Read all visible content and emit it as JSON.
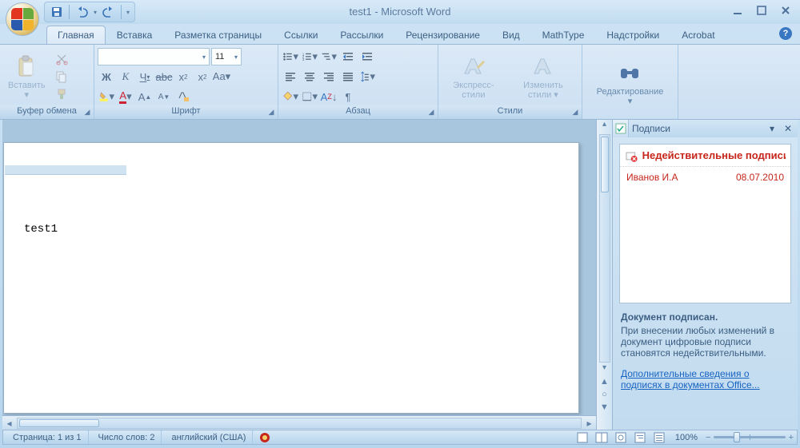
{
  "title": "test1 - Microsoft Word",
  "tabs": {
    "home": "Главная",
    "insert": "Вставка",
    "layout": "Разметка страницы",
    "refs": "Ссылки",
    "mail": "Рассылки",
    "review": "Рецензирование",
    "view": "Вид",
    "mathtype": "MathType",
    "addins": "Надстройки",
    "acrobat": "Acrobat"
  },
  "ribbon": {
    "clipboard": {
      "label": "Буфер обмена",
      "paste": "Вставить"
    },
    "font": {
      "label": "Шрифт",
      "font_name": "",
      "font_size": "11"
    },
    "paragraph": {
      "label": "Абзац"
    },
    "styles": {
      "label": "Стили",
      "quick": "Экспресс-стили",
      "change": "Изменить стили"
    },
    "editing": {
      "label": "Редактирование"
    }
  },
  "document": {
    "text": "test1"
  },
  "panel": {
    "title": "Подписи",
    "invalid_heading": "Недействительные подписи",
    "sig_name": "Иванов И.А",
    "sig_date": "08.07.2010",
    "signed_heading": "Документ подписан.",
    "signed_body": "При внесении любых изменений в документ цифровые подписи становятся недействительными.",
    "link": "Дополнительные сведения о подписях в документах Office..."
  },
  "status": {
    "page": "Страница: 1 из 1",
    "words": "Число слов: 2",
    "lang": "английский (США)",
    "zoom": "100%"
  }
}
